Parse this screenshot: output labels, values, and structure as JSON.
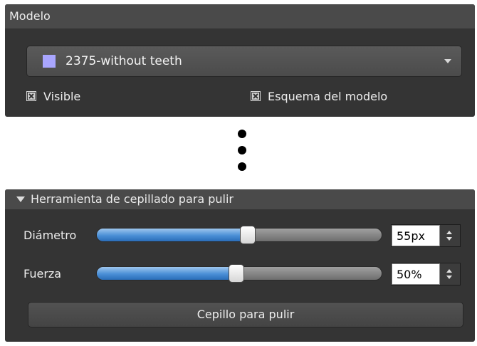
{
  "model_panel": {
    "title": "Modelo",
    "select": {
      "value": "2375-without teeth",
      "swatch_color": "#a9a6ff"
    },
    "checkboxes": [
      {
        "label": "Visible",
        "checked": true
      },
      {
        "label": "Esquema del modelo",
        "checked": true
      }
    ]
  },
  "brush_panel": {
    "title": "Herramienta de cepillado para pulir",
    "expanded": true,
    "diameter": {
      "label": "Diámetro",
      "value_text": "55px",
      "slider_fraction": 0.53
    },
    "force": {
      "label": "Fuerza",
      "value_text": "50%",
      "slider_fraction": 0.49
    },
    "button_label": "Cepillo para pulir"
  },
  "colors": {
    "panel_bg": "#343434",
    "header_bg": "#4a4a4a",
    "slider_fill": "#4a8fd6",
    "separator_dots": "#000000"
  },
  "icons": {
    "header_toggle": "triangle-down-icon",
    "dropdown": "chevron-down-icon",
    "checkbox_mark": "x-mark-icon",
    "spinner": "up-down-arrows-icon"
  }
}
